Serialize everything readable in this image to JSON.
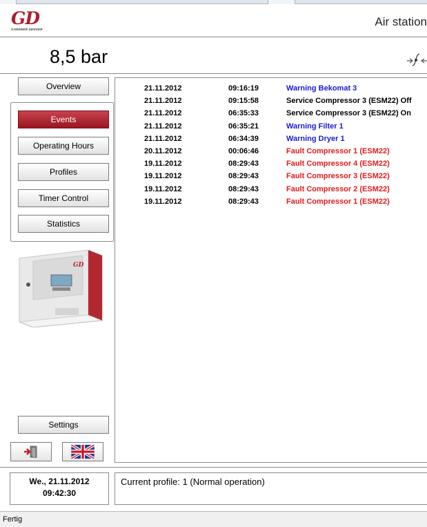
{
  "header": {
    "logo_text": "GD",
    "logo_subtext": "GARDNER DENVER",
    "title": "Air station"
  },
  "pressure": {
    "value": "8,5 bar"
  },
  "sidebar": {
    "overview_label": "Overview",
    "menu": [
      {
        "label": "Events",
        "active": true
      },
      {
        "label": "Operating Hours",
        "active": false
      },
      {
        "label": "Profiles",
        "active": false
      },
      {
        "label": "Timer Control",
        "active": false
      },
      {
        "label": "Statistics",
        "active": false
      }
    ],
    "settings_label": "Settings",
    "device_logo": "GD",
    "logout_icon": "exit-door-icon",
    "language_icon": "uk-flag-icon"
  },
  "events": [
    {
      "date": "21.11.2012",
      "time": "09:16:19",
      "message": "Warning Bekomat 3",
      "type": "warning"
    },
    {
      "date": "21.11.2012",
      "time": "09:15:58",
      "message": "Service Compressor 3 (ESM22) Off",
      "type": "service"
    },
    {
      "date": "21.11.2012",
      "time": "06:35:33",
      "message": "Service Compressor 3 (ESM22) On",
      "type": "service"
    },
    {
      "date": "21.11.2012",
      "time": "06:35:21",
      "message": "Warning Filter 1",
      "type": "warning"
    },
    {
      "date": "21.11.2012",
      "time": "06:34:39",
      "message": "Warning Dryer 1",
      "type": "warning"
    },
    {
      "date": "20.11.2012",
      "time": "00:06:46",
      "message": "Fault Compressor 1 (ESM22)",
      "type": "fault"
    },
    {
      "date": "19.11.2012",
      "time": "08:29:43",
      "message": "Fault Compressor 4 (ESM22)",
      "type": "fault"
    },
    {
      "date": "19.11.2012",
      "time": "08:29:43",
      "message": "Fault Compressor 3 (ESM22)",
      "type": "fault"
    },
    {
      "date": "19.11.2012",
      "time": "08:29:43",
      "message": "Fault Compressor 2 (ESM22)",
      "type": "fault"
    },
    {
      "date": "19.11.2012",
      "time": "08:29:43",
      "message": "Fault Compressor 1 (ESM22)",
      "type": "fault"
    }
  ],
  "colors": {
    "brand_red": "#b01e2e",
    "warning": "#1a1ad6",
    "service": "#000000",
    "fault": "#e21b1b"
  },
  "footer": {
    "day_date": "We., 21.11.2012",
    "time": "09:42:30",
    "profile_text": "Current profile: 1 (Normal operation)"
  },
  "statusbar": {
    "text": "Fertig"
  }
}
